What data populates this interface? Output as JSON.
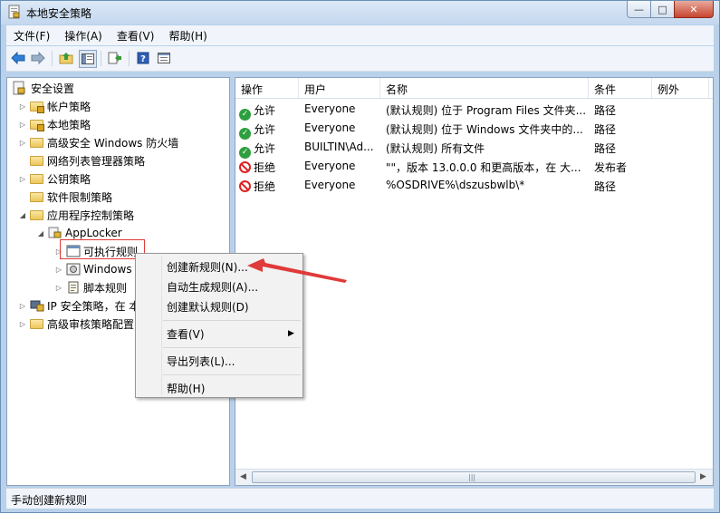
{
  "window": {
    "title": "本地安全策略",
    "minimize": "—",
    "maximize": "□",
    "close": "✕"
  },
  "menubar": {
    "items": [
      "文件(F)",
      "操作(A)",
      "查看(V)",
      "帮助(H)"
    ]
  },
  "toolbar": {
    "icons": [
      "back-icon",
      "forward-icon",
      "up-folder-icon",
      "show-tree-icon",
      "export-list-icon",
      "help-icon",
      "properties-icon"
    ]
  },
  "tree": {
    "root": "安全设置",
    "items": [
      {
        "label": "帐户策略"
      },
      {
        "label": "本地策略"
      },
      {
        "label": "高级安全 Windows 防火墙"
      },
      {
        "label": "网络列表管理器策略"
      },
      {
        "label": "公钥策略"
      },
      {
        "label": "软件限制策略"
      },
      {
        "label": "应用程序控制策略"
      },
      {
        "label": "AppLocker"
      },
      {
        "label": "可执行规则"
      },
      {
        "label": "Windows"
      },
      {
        "label": "脚本规则"
      },
      {
        "label": "IP 安全策略，在 本"
      },
      {
        "label": "高级审核策略配置"
      }
    ]
  },
  "table": {
    "columns": [
      "操作",
      "用户",
      "名称",
      "条件",
      "例外"
    ],
    "rows": [
      {
        "action": "允许",
        "user": "Everyone",
        "name": "(默认规则) 位于 Program Files 文件夹...",
        "condition": "路径",
        "type": "allow"
      },
      {
        "action": "允许",
        "user": "Everyone",
        "name": "(默认规则) 位于 Windows 文件夹中的...",
        "condition": "路径",
        "type": "allow"
      },
      {
        "action": "允许",
        "user": "BUILTIN\\Ad...",
        "name": "(默认规则) 所有文件",
        "condition": "路径",
        "type": "allow"
      },
      {
        "action": "拒绝",
        "user": "Everyone",
        "name": "\"\"，版本 13.0.0.0 和更高版本，在 大...",
        "condition": "发布者",
        "type": "deny"
      },
      {
        "action": "拒绝",
        "user": "Everyone",
        "name": "%OSDRIVE%\\dszusbwlb\\*",
        "condition": "路径",
        "type": "deny"
      }
    ],
    "scroll_grip": "|||"
  },
  "context_menu": {
    "items": [
      "创建新规则(N)...",
      "自动生成规则(A)...",
      "创建默认规则(D)",
      "查看(V)",
      "导出列表(L)...",
      "帮助(H)"
    ],
    "submenu_arrow": "▶"
  },
  "status": {
    "text": "手动创建新规则"
  },
  "colors": {
    "highlight_box": "#e03a3a",
    "arrow": "#e03a3a",
    "allow": "#2e9f3e",
    "deny": "#dd2222"
  }
}
